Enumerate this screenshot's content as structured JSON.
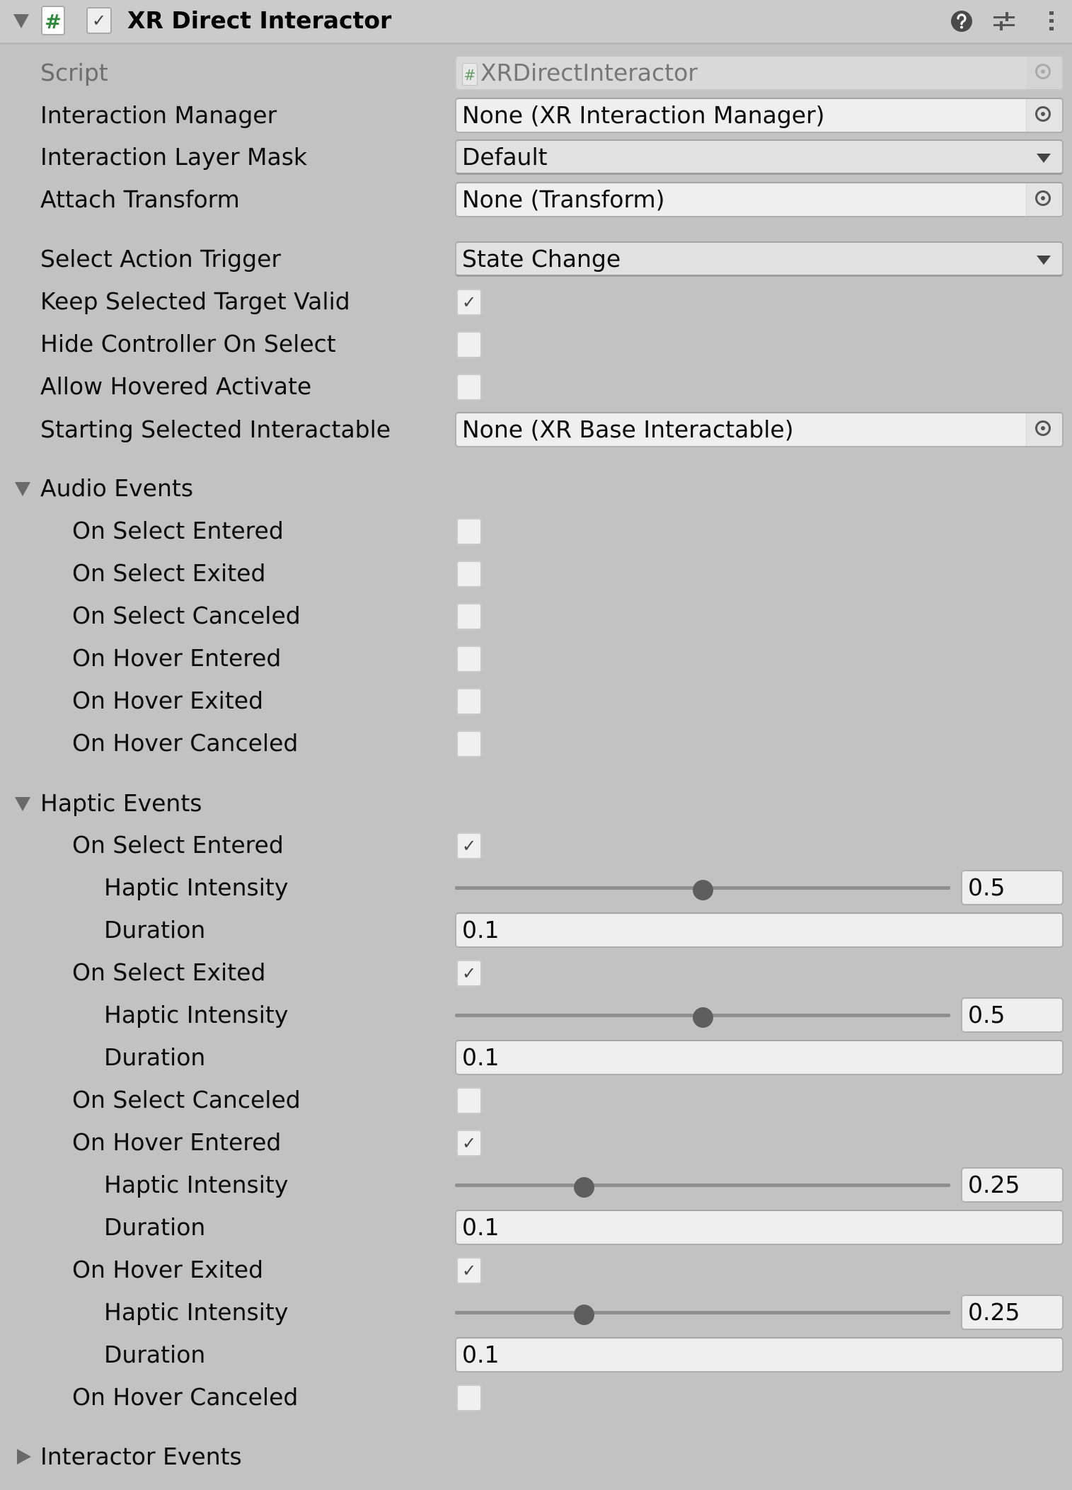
{
  "component": {
    "title": "XR Direct Interactor",
    "enabled": true,
    "icons": {
      "script": "script-hash-icon",
      "help": "help-icon",
      "presets": "sliders-icon",
      "menu": "kebab-menu-icon"
    },
    "script_hash_glyph": "#",
    "check_glyph": "✓"
  },
  "fields": {
    "script": {
      "label": "Script",
      "value": "XRDirectInteractor"
    },
    "interaction_manager": {
      "label": "Interaction Manager",
      "value": "None (XR Interaction Manager)"
    },
    "interaction_layer_mask": {
      "label": "Interaction Layer Mask",
      "value": "Default"
    },
    "attach_transform": {
      "label": "Attach Transform",
      "value": "None (Transform)"
    },
    "select_action_trigger": {
      "label": "Select Action Trigger",
      "value": "State Change"
    },
    "keep_selected_target_valid": {
      "label": "Keep Selected Target Valid",
      "checked": true
    },
    "hide_controller_on_select": {
      "label": "Hide Controller On Select",
      "checked": false
    },
    "allow_hovered_activate": {
      "label": "Allow Hovered Activate",
      "checked": false
    },
    "starting_selected_interactable": {
      "label": "Starting Selected Interactable",
      "value": "None (XR Base Interactable)"
    }
  },
  "audio_events": {
    "label": "Audio Events",
    "expanded": true,
    "items": [
      {
        "label": "On Select Entered",
        "checked": false
      },
      {
        "label": "On Select Exited",
        "checked": false
      },
      {
        "label": "On Select Canceled",
        "checked": false
      },
      {
        "label": "On Hover Entered",
        "checked": false
      },
      {
        "label": "On Hover Exited",
        "checked": false
      },
      {
        "label": "On Hover Canceled",
        "checked": false
      }
    ]
  },
  "haptic_events": {
    "label": "Haptic Events",
    "expanded": true,
    "intensity_label": "Haptic Intensity",
    "duration_label": "Duration",
    "slider_range": [
      0,
      1
    ],
    "items": [
      {
        "label": "On Select Entered",
        "checked": true,
        "intensity": "0.5",
        "duration": "0.1"
      },
      {
        "label": "On Select Exited",
        "checked": true,
        "intensity": "0.5",
        "duration": "0.1"
      },
      {
        "label": "On Select Canceled",
        "checked": false
      },
      {
        "label": "On Hover Entered",
        "checked": true,
        "intensity": "0.25",
        "duration": "0.1"
      },
      {
        "label": "On Hover Exited",
        "checked": true,
        "intensity": "0.25",
        "duration": "0.1"
      },
      {
        "label": "On Hover Canceled",
        "checked": false
      }
    ]
  },
  "interactor_events": {
    "label": "Interactor Events",
    "expanded": false
  }
}
